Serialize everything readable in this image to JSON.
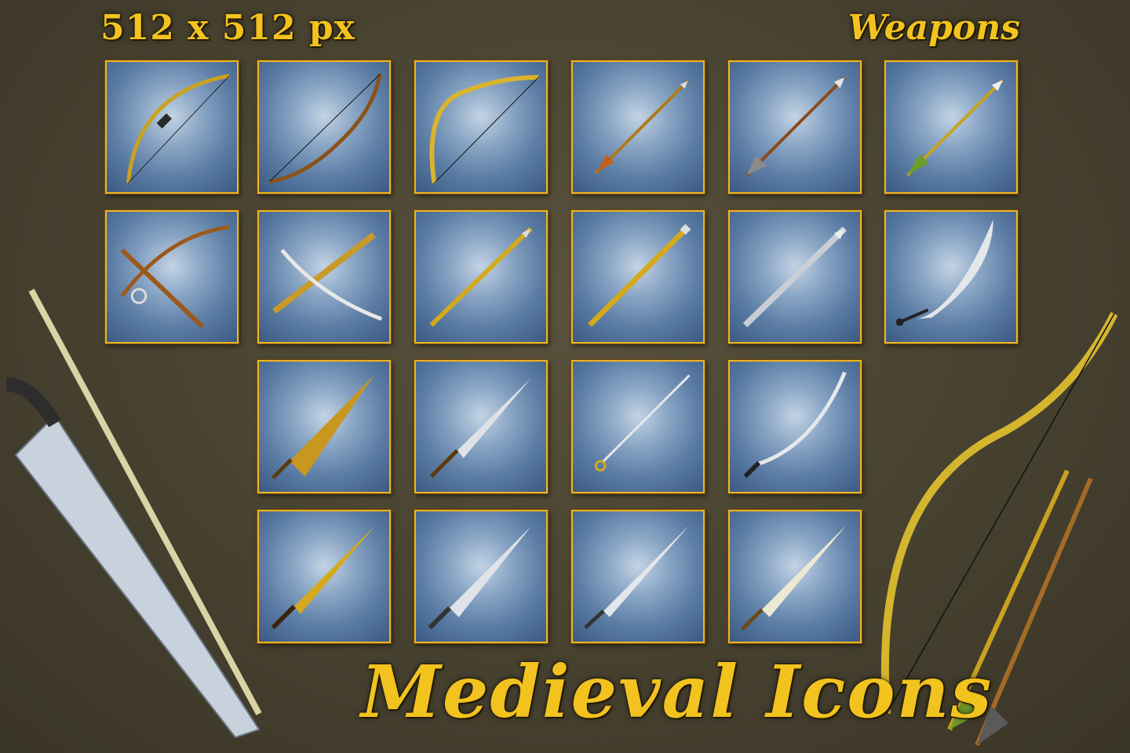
{
  "header": {
    "size_label": "512 x 512 px",
    "category_label": "Weapons"
  },
  "footer": {
    "title": "Medieval Icons"
  },
  "colors": {
    "accent": "#f2c21f",
    "frame": "#f0b420",
    "tile_bg": "#5b7ca4"
  },
  "icons": [
    "longbow-icon",
    "recurve-bow-icon",
    "wrapped-bow-icon",
    "orange-arrow-icon",
    "barbed-arrow-icon",
    "green-fletch-arrow-icon",
    "wooden-crossbow-icon",
    "heavy-crossbow-icon",
    "gold-spear-icon",
    "gold-staff-icon",
    "steel-spear-icon",
    "scimitar-icon",
    "bronze-broadsword-icon",
    "steel-longsword-icon",
    "rapier-icon",
    "sabre-icon",
    "gold-dagger-sword-icon",
    "ornate-sword-icon",
    "cross-hilt-sword-icon",
    "bastard-sword-icon"
  ]
}
